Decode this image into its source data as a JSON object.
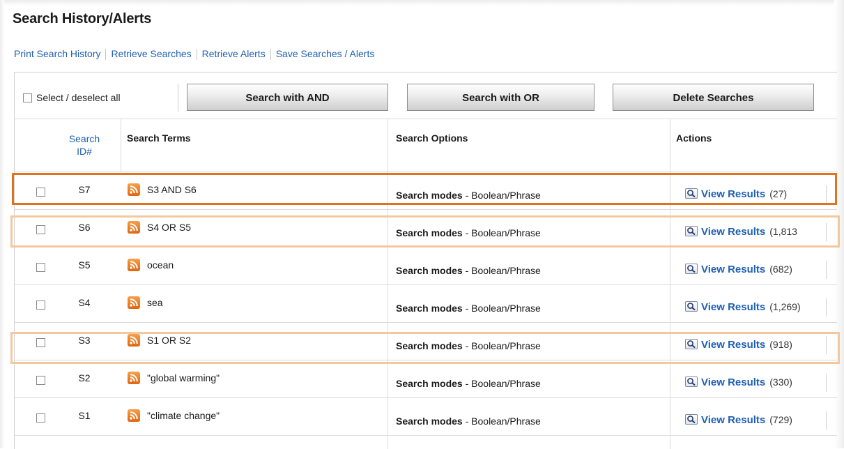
{
  "page": {
    "title": "Search History/Alerts"
  },
  "links": [
    {
      "label": "Print Search History"
    },
    {
      "label": "Retrieve Searches"
    },
    {
      "label": "Retrieve Alerts"
    },
    {
      "label": "Save Searches / Alerts"
    }
  ],
  "toolbar": {
    "select_all_label": "Select / deselect all",
    "and_button": "Search with AND",
    "or_button": "Search with OR",
    "delete_button": "Delete Searches"
  },
  "table": {
    "headers": {
      "id": "Search ID#",
      "terms": "Search Terms",
      "options": "Search Options",
      "actions": "Actions"
    },
    "option_label": "Search modes",
    "option_value": "- Boolean/Phrase",
    "view_label": "View Results",
    "rows": [
      {
        "id": "S7",
        "term": "S3 AND S6",
        "count": "(27)",
        "highlight": "strong"
      },
      {
        "id": "S6",
        "term": "S4 OR S5",
        "count": "(1,813",
        "highlight": "light"
      },
      {
        "id": "S5",
        "term": "ocean",
        "count": "(682)",
        "highlight": "none"
      },
      {
        "id": "S4",
        "term": "sea",
        "count": "(1,269)",
        "highlight": "none"
      },
      {
        "id": "S3",
        "term": "S1 OR S2",
        "count": "(918)",
        "highlight": "light"
      },
      {
        "id": "S2",
        "term": "\"global warming\"",
        "count": "(330)",
        "highlight": "none"
      },
      {
        "id": "S1",
        "term": "\"climate change\"",
        "count": "(729)",
        "highlight": "none"
      }
    ]
  },
  "colors": {
    "link": "#1f5fb2",
    "highlight_strong": "#e07320",
    "highlight_light": "#f4c89e",
    "rss": "#e8761c"
  },
  "icons": {
    "feed": "rss-icon",
    "view": "magnifier-icon"
  }
}
